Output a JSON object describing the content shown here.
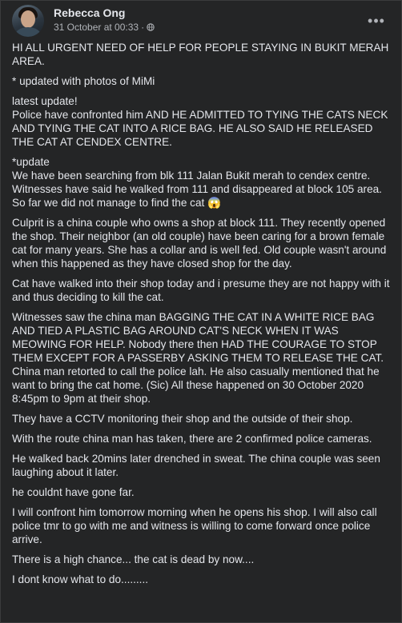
{
  "post": {
    "author": "Rebecca Ong",
    "timestamp": "31 October at 00:33",
    "separator": "·",
    "privacy_icon": "globe-icon",
    "more_icon": "more-options-icon",
    "more_label": "•••",
    "paragraphs": [
      "HI ALL URGENT NEED OF HELP FOR PEOPLE STAYING IN BUKIT MERAH AREA.",
      "* updated with photos of MiMi",
      "latest update!\nPolice have confronted him AND HE ADMITTED TO TYING THE CATS NECK AND TYING THE CAT INTO A RICE BAG. HE ALSO SAID HE RELEASED THE CAT AT CENDEX CENTRE.",
      "*update\nWe have been searching from blk 111 Jalan Bukit merah to cendex centre. Witnesses have said he walked from 111 and disappeared at block 105 area. So far we did not manage to find the cat 😱",
      "Culprit is a china couple who owns a shop at block 111. They recently opened the shop. Their neighbor (an old couple) have been caring for a brown female cat for many years. She has a collar and is well fed. Old couple wasn't around when this happened as they have closed shop for the day.",
      "Cat have walked into their shop today and i presume they are not happy with it and thus deciding to kill the cat.",
      "Witnesses saw the china man BAGGING THE CAT IN A WHITE RICE BAG AND TIED A PLASTIC BAG AROUND CAT'S NECK WHEN IT WAS MEOWING FOR HELP. Nobody there then HAD THE COURAGE TO STOP THEM EXCEPT FOR A PASSERBY ASKING THEM TO RELEASE THE CAT. China man retorted to call the police lah. He also casually mentioned that he want to bring the cat home. (Sic) All these happened on 30 October 2020 8:45pm to 9pm at their shop.",
      "They have a CCTV monitoring their shop and the outside of their shop.",
      "With the route china man has taken, there are 2 confirmed police cameras.",
      "He walked back 20mins later drenched in sweat. The china couple was seen laughing about it later.",
      "he couldnt have gone far.",
      "I will confront him tomorrow morning when he opens his shop. I will also call police tmr to go with me and witness is willing to come forward once police arrive.",
      "There is a high chance... the cat is dead by now....",
      "I dont know what to do........."
    ]
  },
  "colors": {
    "background": "#242526",
    "text": "#e4e6eb",
    "secondary_text": "#b0b3b8"
  }
}
